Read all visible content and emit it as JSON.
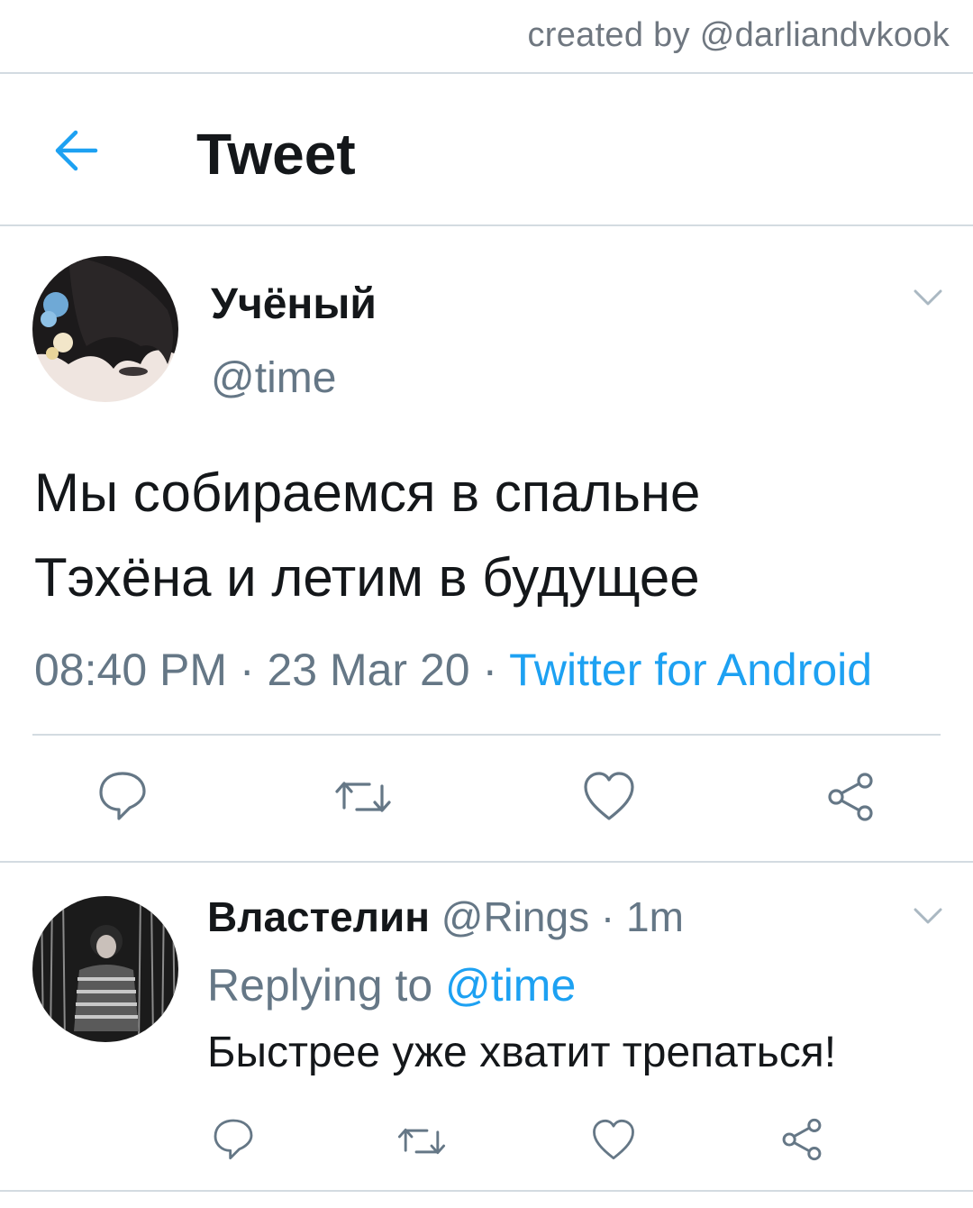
{
  "watermark": "created by @darliandvkook",
  "header": {
    "title": "Tweet"
  },
  "tweet": {
    "display_name": "Учёный",
    "handle": "@time",
    "text_line1": "Мы собираемся в спальне",
    "text_line2": "Тэхёна и летим в будущее",
    "time": "08:40 PM",
    "sep": " · ",
    "date": "23 Mar 20",
    "source": "Twitter for Android"
  },
  "reply": {
    "display_name": "Властелин",
    "handle": "@Rings",
    "age": " · 1m",
    "replying_prefix": "Replying to ",
    "replying_mention": "@time",
    "text": "Быстрее уже хватит трепаться!"
  },
  "colors": {
    "accent": "#1da1f2",
    "muted": "#657786",
    "divider": "#d3dbe1"
  }
}
